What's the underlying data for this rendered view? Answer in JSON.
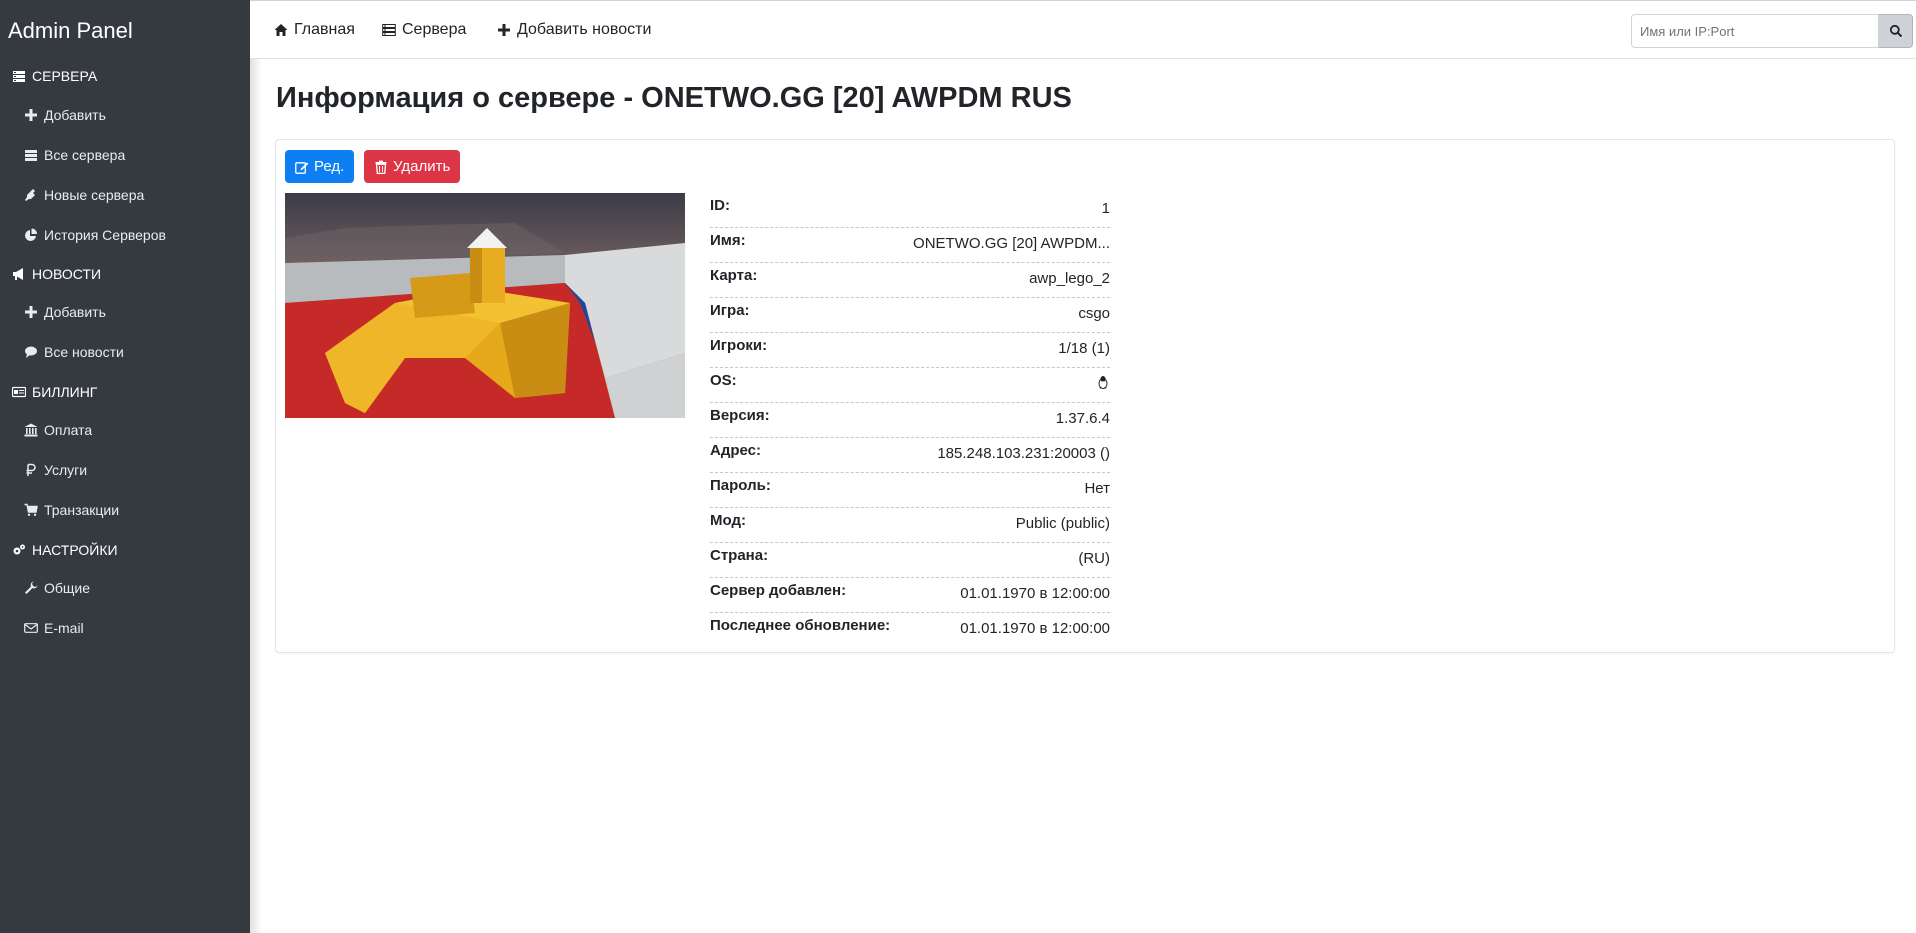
{
  "sidebar": {
    "brand": "Admin Panel",
    "sections": {
      "servers": "СЕРВЕРА",
      "news": "НОВОСТИ",
      "billing": "БИЛЛИНГ",
      "settings": "НАСТРОЙКИ"
    },
    "items": {
      "servers_add": "Добавить",
      "servers_all": "Все сервера",
      "servers_new": "Новые сервера",
      "servers_history": "История Серверов",
      "news_add": "Добавить",
      "news_all": "Все новости",
      "billing_payment": "Оплата",
      "billing_services": "Услуги",
      "billing_transactions": "Транзакции",
      "settings_general": "Общие",
      "settings_email": "E-mail"
    }
  },
  "nav": {
    "home": "Главная",
    "servers": "Сервера",
    "add_news": "Добавить новости",
    "search_placeholder": "Имя или IP:Port"
  },
  "page": {
    "title": "Информация о сервере - ONETWO.GG [20] AWPDM RUS",
    "edit_label": "Ред.",
    "delete_label": "Удалить"
  },
  "info": [
    {
      "key": "ID:",
      "value": "1"
    },
    {
      "key": "Имя:",
      "value": "ONETWO.GG [20] AWPDM..."
    },
    {
      "key": "Карта:",
      "value": "awp_lego_2"
    },
    {
      "key": "Игра:",
      "value": "csgo"
    },
    {
      "key": "Игроки:",
      "value": "1/18 (1)"
    },
    {
      "key": "OS:",
      "value": "",
      "icon": "linux-icon"
    },
    {
      "key": "Версия:",
      "value": "1.37.6.4"
    },
    {
      "key": "Адрес:",
      "value": "185.248.103.231:20003 ()"
    },
    {
      "key": "Пароль:",
      "value": "Нет"
    },
    {
      "key": "Мод:",
      "value": "Public (public)"
    },
    {
      "key": "Страна:",
      "value": "(RU)"
    },
    {
      "key": "Сервер добавлен:",
      "value": "01.01.1970 в 12:00:00"
    },
    {
      "key": "Последнее обновление:",
      "value": "01.01.1970 в 12:00:00"
    }
  ],
  "colors": {
    "sidebar_bg": "#343a40",
    "primary": "#0d7ff2",
    "danger": "#dc3545"
  }
}
